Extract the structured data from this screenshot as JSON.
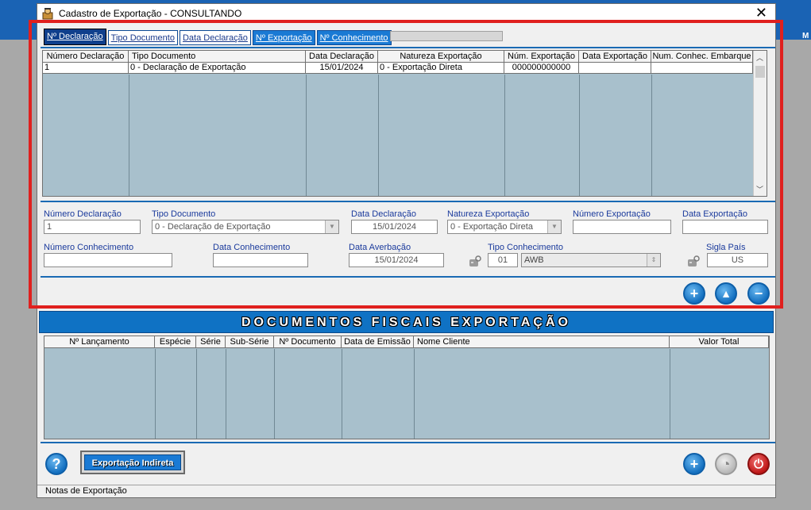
{
  "window": {
    "title": "Cadastro de Exportação  -  CONSULTANDO"
  },
  "tabs": [
    {
      "label": "Nº Declaração"
    },
    {
      "label": "Tipo Documento"
    },
    {
      "label": "Data Declaração"
    },
    {
      "label": "Nº Exportação"
    },
    {
      "label": "Nº Conhecimento"
    }
  ],
  "decl_grid": {
    "headers": [
      "Número Declaração",
      "Tipo Documento",
      "Data Declaração",
      "Natureza Exportação",
      "Núm. Exportação",
      "Data Exportação",
      "Num. Conhec. Embarque"
    ],
    "rows": [
      [
        "1",
        "0 - Declaração de Exportação",
        "15/01/2024",
        "0 - Exportação Direta",
        "000000000000",
        "",
        ""
      ]
    ]
  },
  "form": {
    "numero_declaracao": {
      "label": "Número Declaração",
      "value": "1"
    },
    "tipo_documento": {
      "label": "Tipo Documento",
      "value": "0 - Declaração de Exportação"
    },
    "data_declaracao": {
      "label": "Data Declaração",
      "value": "15/01/2024"
    },
    "natureza_exportacao": {
      "label": "Natureza Exportação",
      "value": "0 - Exportação Direta"
    },
    "numero_exportacao": {
      "label": "Número Exportação",
      "value": ""
    },
    "data_exportacao": {
      "label": "Data Exportação",
      "value": ""
    },
    "numero_conhecimento": {
      "label": "Número Conhecimento",
      "value": ""
    },
    "data_conhecimento": {
      "label": "Data Conhecimento",
      "value": ""
    },
    "data_averbacao": {
      "label": "Data Averbação",
      "value": "15/01/2024"
    },
    "tipo_conhecimento": {
      "label": "Tipo Conhecimento",
      "code": "01",
      "value": "AWB"
    },
    "sigla_pais": {
      "label": "Sigla País",
      "value": "US"
    }
  },
  "section_title": "DOCUMENTOS FISCAIS EXPORTAÇÃO",
  "docs_grid": {
    "headers": [
      "Nº Lançamento",
      "Espécie",
      "Série",
      "Sub-Série",
      "Nº Documento",
      "Data de Emissão",
      "Nome Cliente",
      "Valor Total"
    ]
  },
  "buttons": {
    "exportacao_indireta": "Exportação Indireta"
  },
  "statusbar": {
    "text": "Notas de Exportação"
  },
  "colors": {
    "accent": "#1a7ad4",
    "frame": "#e0201e",
    "grid_bg": "#a8c0cc"
  }
}
